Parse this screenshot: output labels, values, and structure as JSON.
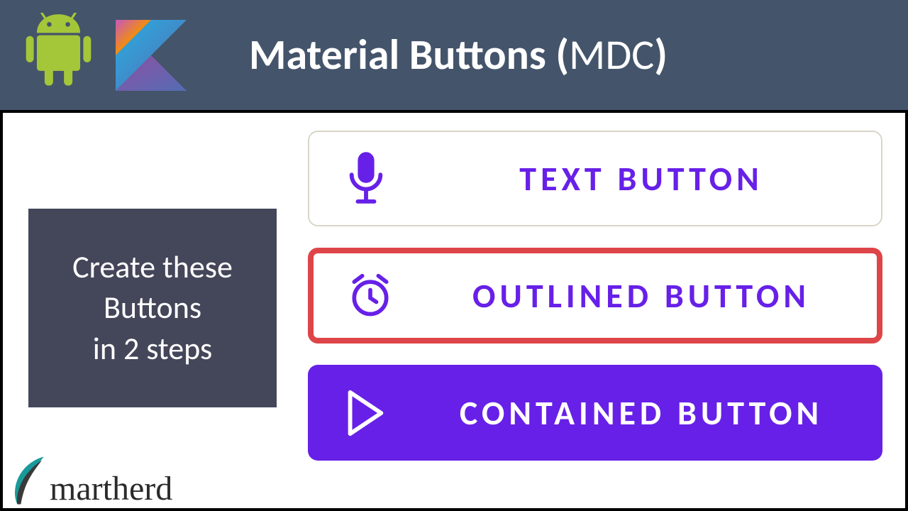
{
  "header": {
    "title_main": "Material Buttons ",
    "title_paren_open": "(",
    "title_sub": "MDC",
    "title_paren_close": ")"
  },
  "subtitle": "Create these\nButtons\nin 2 steps",
  "buttons": {
    "text": {
      "label": "TEXT BUTTON",
      "icon": "microphone"
    },
    "outlined": {
      "label": "OUTLINED BUTTON",
      "icon": "alarm"
    },
    "contained": {
      "label": "CONTAINED BUTTON",
      "icon": "play"
    }
  },
  "colors": {
    "accent": "#6720e8",
    "header_bg": "#44546a",
    "outline_highlight": "#de4548"
  },
  "brand": "martherd"
}
